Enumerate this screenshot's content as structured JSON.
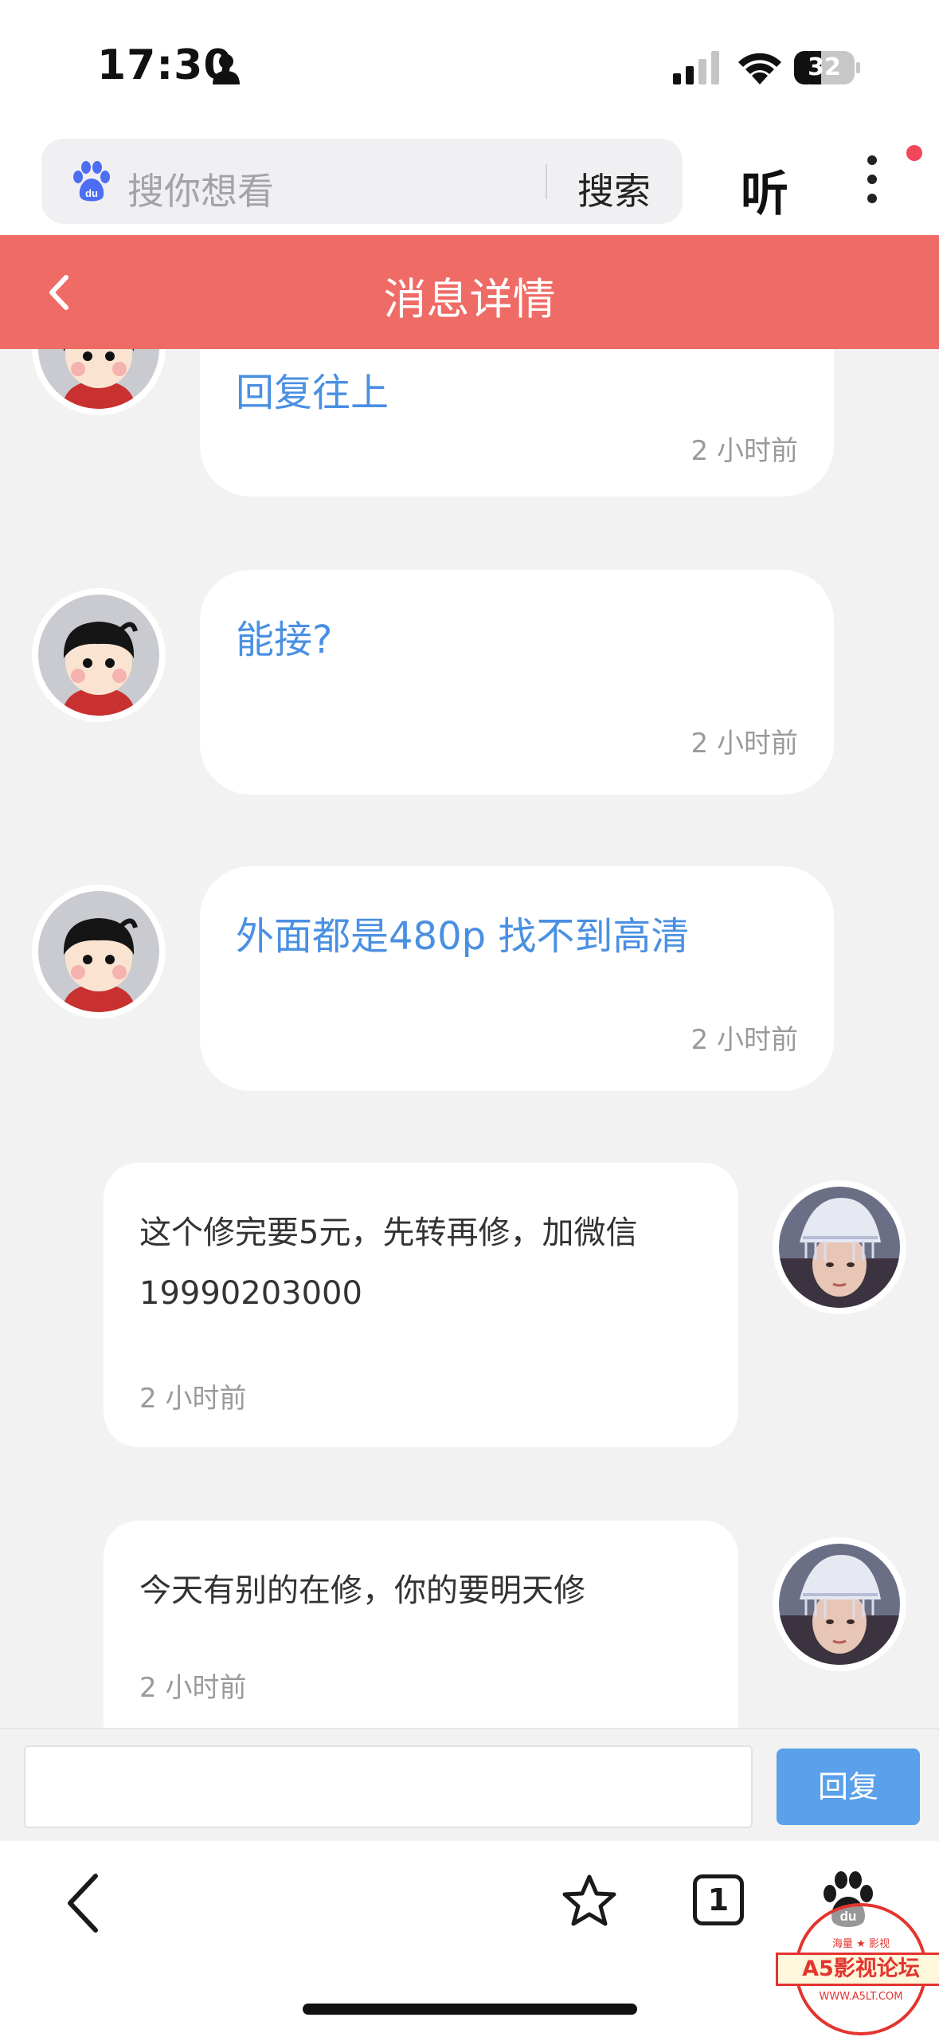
{
  "status_bar": {
    "time": "17:30",
    "battery": "32"
  },
  "search": {
    "placeholder": "搜你想看",
    "button": "搜索",
    "listen": "听"
  },
  "header": {
    "title": "消息详情"
  },
  "messages": [
    {
      "direction": "incoming",
      "text": "回复往上",
      "time": "2 小时前"
    },
    {
      "direction": "incoming",
      "text": "能接?",
      "time": "2 小时前"
    },
    {
      "direction": "incoming",
      "text": "外面都是480p  找不到高清",
      "time": "2 小时前"
    },
    {
      "direction": "outgoing",
      "text": "这个修完要5元，先转再修，加微信19990203000",
      "time": "2 小时前"
    },
    {
      "direction": "outgoing",
      "text": "今天有别的在修，你的要明天修",
      "time": "2 小时前"
    }
  ],
  "reply": {
    "input_value": "",
    "button": "回复"
  },
  "toolbar": {
    "tab_count": "1"
  },
  "watermark": {
    "top": "海量 ★ 影视",
    "label": "A5影视论坛",
    "url": "WWW.A5LT.COM"
  },
  "colors": {
    "header_bg": "#ee6b66",
    "incoming_text": "#4a90e2",
    "reply_button": "#5aa0ea",
    "background": "#f2f2f2"
  },
  "icons": [
    "person-icon",
    "signal-icon",
    "wifi-icon",
    "battery-icon",
    "baidu-paw-icon",
    "more-icon",
    "back-icon",
    "star-icon",
    "tabs-icon",
    "baidu-paw-icon"
  ]
}
